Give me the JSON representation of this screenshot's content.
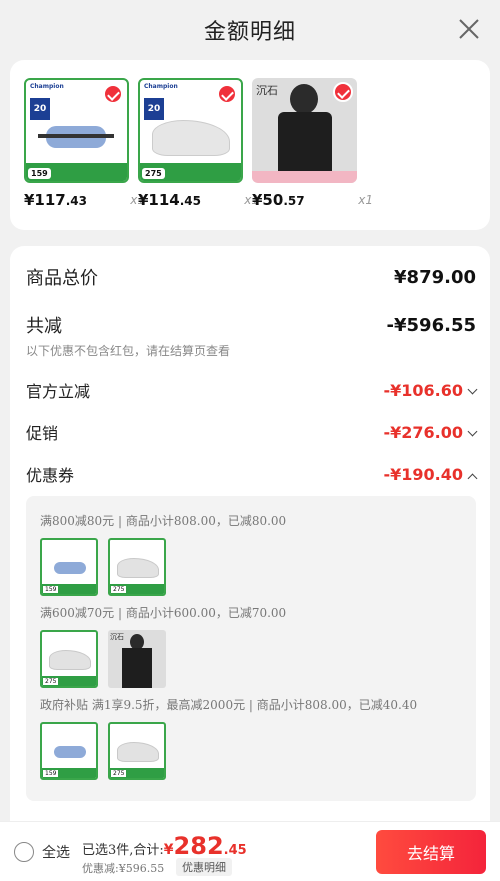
{
  "header": {
    "title": "金额明细"
  },
  "products": [
    {
      "price_int": "¥117",
      "price_dec": ".43",
      "qty": "x1",
      "thumb_price": "159",
      "thumb_badge": "20"
    },
    {
      "price_int": "¥114",
      "price_dec": ".45",
      "qty": "x1",
      "thumb_price": "275",
      "thumb_badge": "20"
    },
    {
      "price_int": "¥50",
      "price_dec": ".57",
      "qty": "x1",
      "thumb_label": "沉石"
    }
  ],
  "summary": {
    "total_label": "商品总价",
    "total_value": "¥879.00",
    "discount_label": "共减",
    "discount_value": "-¥596.55",
    "note": "以下优惠不包含红包，请在结算页查看",
    "official_label": "官方立减",
    "official_value": "-¥106.60",
    "promo_label": "促销",
    "promo_value": "-¥276.00",
    "coupon_label": "优惠券",
    "coupon_value": "-¥190.40"
  },
  "coupons": [
    {
      "rule": "满800减80元 | 商品小计808.00，已减80.00"
    },
    {
      "rule": "满600减70元 | 商品小计600.00，已减70.00"
    },
    {
      "rule": "政府补贴 满1享9.5折，最高减2000元 | 商品小计808.00，已减40.40"
    }
  ],
  "footer": {
    "select_all": "全选",
    "selected_text": "已选3件,合计:",
    "currency": "¥",
    "total_int": "282",
    "total_dec": ".45",
    "discount_text": "优惠减:¥596.55",
    "detail_link": "优惠明细",
    "checkout": "去结算"
  },
  "colors": {
    "accent": "#e8312b",
    "check": "#f0313b",
    "brand_green": "#2f9e44"
  }
}
